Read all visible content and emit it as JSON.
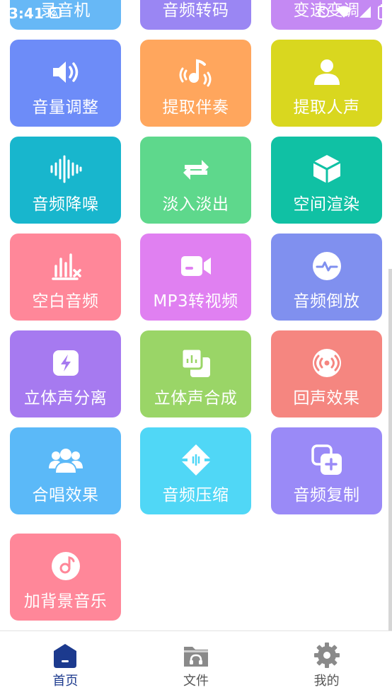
{
  "status_bar": {
    "time": "3:41"
  },
  "tiles": [
    {
      "label": "录音机",
      "color": "#67b8f6",
      "icon": "microphone-icon"
    },
    {
      "label": "音频转码",
      "color": "#9a86f3",
      "icon": "transcode-icon"
    },
    {
      "label": "变速变调",
      "color": "#c489f3",
      "icon": "speed-pitch-icon"
    },
    {
      "label": "音量调整",
      "color": "#6d8cf8",
      "icon": "speaker-icon"
    },
    {
      "label": "提取伴奏",
      "color": "#ffa65d",
      "icon": "music-note-icon"
    },
    {
      "label": "提取人声",
      "color": "#d9d71f",
      "icon": "person-icon"
    },
    {
      "label": "音频降噪",
      "color": "#18b6cd",
      "icon": "waveform-icon"
    },
    {
      "label": "淡入淡出",
      "color": "#5ed88c",
      "icon": "swap-arrows-icon"
    },
    {
      "label": "空间渲染",
      "color": "#10c1a4",
      "icon": "cube-icon"
    },
    {
      "label": "空白音频",
      "color": "#ff8799",
      "icon": "bars-x-icon"
    },
    {
      "label": "MP3转视频",
      "color": "#e080f1",
      "icon": "video-camera-icon"
    },
    {
      "label": "音频倒放",
      "color": "#8090ef",
      "icon": "pulse-circle-icon"
    },
    {
      "label": "立体声分离",
      "color": "#a67af0",
      "icon": "lightning-icon"
    },
    {
      "label": "立体声合成",
      "color": "#9ad567",
      "icon": "stacked-squares-icon"
    },
    {
      "label": "回声效果",
      "color": "#f58680",
      "icon": "broadcast-icon"
    },
    {
      "label": "合唱效果",
      "color": "#5bb9f8",
      "icon": "group-icon"
    },
    {
      "label": "音频压缩",
      "color": "#50d7f6",
      "icon": "compress-icon"
    },
    {
      "label": "音频复制",
      "color": "#9a8af7",
      "icon": "copy-plus-icon"
    },
    {
      "label": "加背景音乐",
      "color": "#ff8799",
      "icon": "music-disc-icon"
    }
  ],
  "bottom_nav": [
    {
      "label": "首页",
      "icon": "home-icon",
      "active": true
    },
    {
      "label": "文件",
      "icon": "folder-headphones-icon",
      "active": false
    },
    {
      "label": "我的",
      "icon": "gear-icon",
      "active": false
    }
  ],
  "colors": {
    "nav_active": "#1c3a8e",
    "nav_inactive": "#555555",
    "nav_icon_inactive": "#8a8a8a"
  }
}
